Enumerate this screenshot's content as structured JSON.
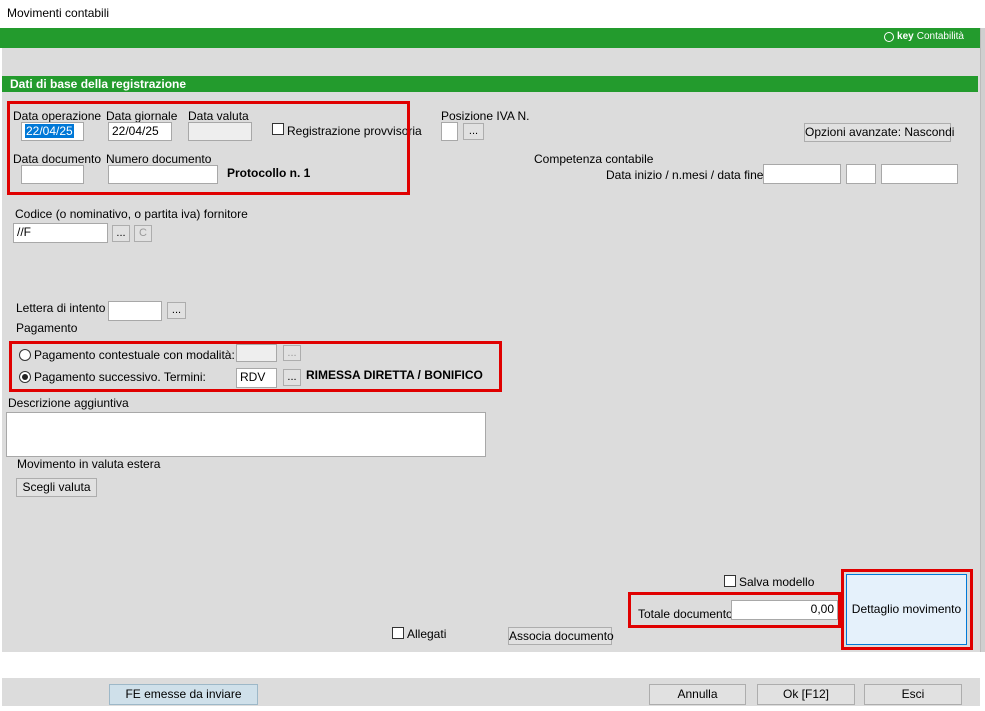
{
  "window": {
    "title": "Movimenti contabili"
  },
  "brand": {
    "prefix": "key",
    "name": "Contabilità"
  },
  "section": {
    "title": "Dati di base della registrazione"
  },
  "dates": {
    "data_operazione_label": "Data operazione",
    "data_operazione_value": "22/04/25",
    "data_giornale_label": "Data giornale",
    "data_giornale_value": "22/04/25",
    "data_valuta_label": "Data valuta",
    "data_valuta_value": "",
    "reg_provvisoria_label": "Registrazione provvisoria",
    "data_documento_label": "Data documento",
    "data_documento_value": "",
    "numero_documento_label": "Numero documento",
    "numero_documento_value": "",
    "protocollo": "Protocollo n. 1"
  },
  "iva": {
    "posizione_label": "Posizione IVA N.",
    "browse": "..."
  },
  "opzioni_button": "Opzioni avanzate: Nascondi",
  "competenza": {
    "title": "Competenza contabile",
    "sub_label": "Data inizio / n.mesi / data fine"
  },
  "fornitore": {
    "label": "Codice (o nominativo, o partita iva) fornitore",
    "value": "//F",
    "browse": "...",
    "c_button": "C"
  },
  "intento": {
    "label": "Lettera di intento",
    "browse": "..."
  },
  "pagamento": {
    "title": "Pagamento",
    "contestuale_label": "Pagamento contestuale con modalità:",
    "contestuale_browse": "...",
    "successivo_label": "Pagamento successivo. Termini:",
    "successivo_value": "RDV",
    "successivo_browse": "...",
    "termini_desc": "RIMESSA DIRETTA / BONIFICO"
  },
  "descrizione": {
    "label": "Descrizione aggiuntiva",
    "value": ""
  },
  "valuta": {
    "label": "Movimento in valuta estera",
    "button": "Scegli valuta"
  },
  "salva_modello": "Salva modello",
  "totale": {
    "label": "Totale documento",
    "value": "0,00"
  },
  "dettaglio_button": "Dettaglio movimento",
  "allegati": "Allegati",
  "associa_button": "Associa documento",
  "footer": {
    "fe_button": "FE emesse da inviare",
    "annulla": "Annulla",
    "ok": "Ok [F12]",
    "esci": "Esci"
  }
}
